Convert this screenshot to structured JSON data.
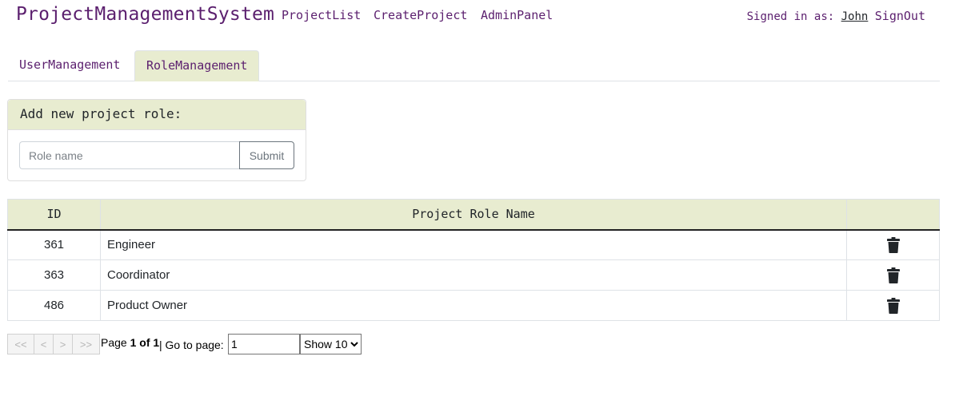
{
  "navbar": {
    "brand": "ProjectManagementSystem",
    "links": [
      "ProjectList",
      "CreateProject",
      "AdminPanel"
    ],
    "signed_in_label": "Signed in as:",
    "user": "John",
    "signout": "SignOut"
  },
  "tabs": [
    {
      "label": "UserManagement",
      "active": false
    },
    {
      "label": "RoleManagement",
      "active": true
    }
  ],
  "add_role": {
    "title": "Add new project role:",
    "placeholder": "Role name",
    "value": "",
    "submit_label": "Submit"
  },
  "table": {
    "headers": [
      "ID",
      "Project Role Name",
      ""
    ],
    "rows": [
      {
        "id": "361",
        "name": "Engineer",
        "action_icon": "trash-icon"
      },
      {
        "id": "363",
        "name": "Coordinator",
        "action_icon": "trash-icon"
      },
      {
        "id": "486",
        "name": "Product Owner",
        "action_icon": "trash-icon"
      }
    ]
  },
  "pagination": {
    "first": "<<",
    "prev": "<",
    "next": ">",
    "last": ">>",
    "page_prefix": "Page",
    "page_current": "1 of 1",
    "goto_label": "| Go to page:",
    "goto_value": "1",
    "show_selected": "Show 10"
  },
  "colors": {
    "brand": "#5b1f6e",
    "header_bg": "#e8ecd0"
  }
}
